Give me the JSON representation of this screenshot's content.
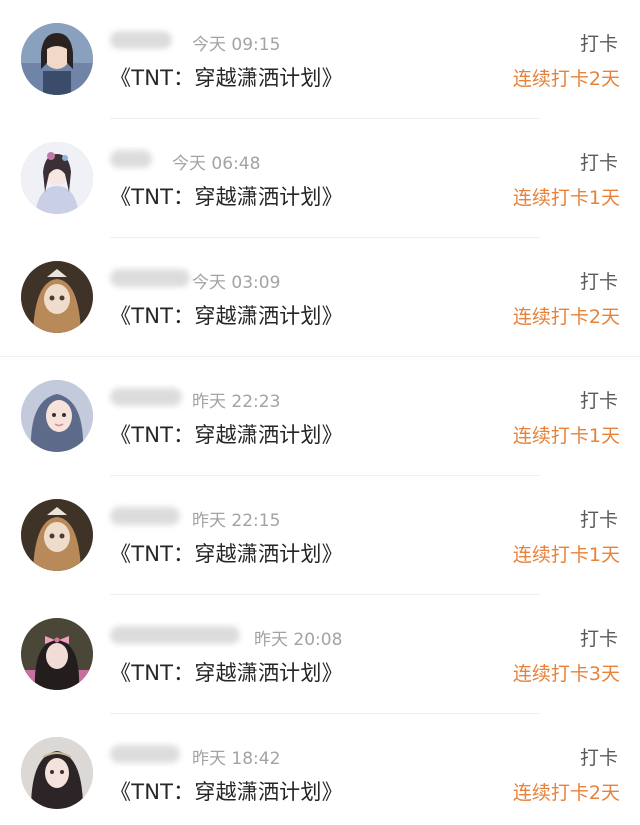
{
  "feed": {
    "items": [
      {
        "avatar": "girl-photo-avatar",
        "time": "今天 09:15",
        "title": "《TNT：穿越潇洒计划》",
        "action": "打卡",
        "streak": "连续打卡2天",
        "bg": "#7f97b8"
      },
      {
        "avatar": "ancient-style-illustration-avatar",
        "time": "今天 06:48",
        "title": "《TNT：穿越潇洒计划》",
        "action": "打卡",
        "streak": "连续打卡1天",
        "bg": "#eef0f5"
      },
      {
        "avatar": "doll-avatar",
        "time": "今天 03:09",
        "title": "《TNT：穿越潇洒计划》",
        "action": "打卡",
        "streak": "连续打卡2天",
        "bg": "#4a3a2e"
      },
      {
        "avatar": "girl-selfie-avatar",
        "time": "昨天 22:23",
        "title": "《TNT：穿越潇洒计划》",
        "action": "打卡",
        "streak": "连续打卡1天",
        "bg": "#b9c2d4"
      },
      {
        "avatar": "doll-avatar",
        "time": "昨天 22:15",
        "title": "《TNT：穿越潇洒计划》",
        "action": "打卡",
        "streak": "连续打卡1天",
        "bg": "#4a3a2e"
      },
      {
        "avatar": "pink-bow-girl-avatar",
        "time": "昨天 20:08",
        "title": "《TNT：穿越潇洒计划》",
        "action": "打卡",
        "streak": "连续打卡3天",
        "bg": "#4d4a3a"
      },
      {
        "avatar": "doll-portrait-avatar",
        "time": "昨天 18:42",
        "title": "《TNT：穿越潇洒计划》",
        "action": "打卡",
        "streak": "连续打卡2天",
        "bg": "#d8d4d2"
      }
    ]
  },
  "colors": {
    "accent": "#e8823a",
    "time": "#a3a3a3",
    "title": "#262626",
    "action": "#5a5a5a"
  }
}
